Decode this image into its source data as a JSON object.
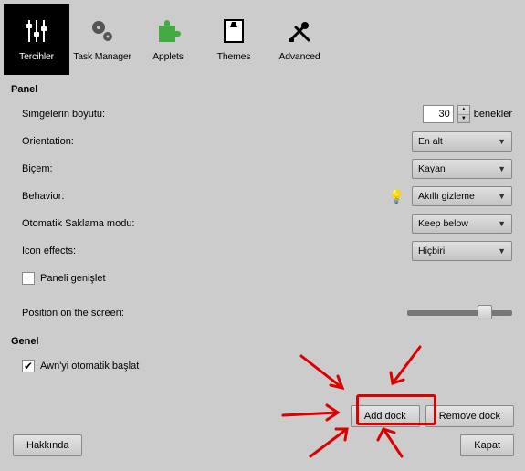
{
  "tabs": {
    "prefs": "Tercihler",
    "taskmgr": "Task Manager",
    "applets": "Applets",
    "themes": "Themes",
    "advanced": "Advanced"
  },
  "sections": {
    "panel": "Panel",
    "general": "Genel"
  },
  "rows": {
    "iconsize": "Simgelerin boyutu:",
    "orientation": "Orientation:",
    "style": "Biçem:",
    "behavior": "Behavior:",
    "autohide": "Otomatik Saklama modu:",
    "iconeffects": "Icon effects:",
    "expand": "Paneli genişlet",
    "position": "Position on the screen:",
    "autostart": "Awn'yi otomatik başlat"
  },
  "values": {
    "iconsize": "30",
    "iconsize_unit": "benekler",
    "orientation": "En alt",
    "style": "Kayan",
    "behavior": "Akıllı gizleme",
    "autohide": "Keep below",
    "iconeffects": "Hiçbiri",
    "expand_checked": false,
    "autostart_checked": true
  },
  "buttons": {
    "adddock": "Add dock",
    "removedock": "Remove dock",
    "about": "Hakkında",
    "close": "Kapat"
  }
}
